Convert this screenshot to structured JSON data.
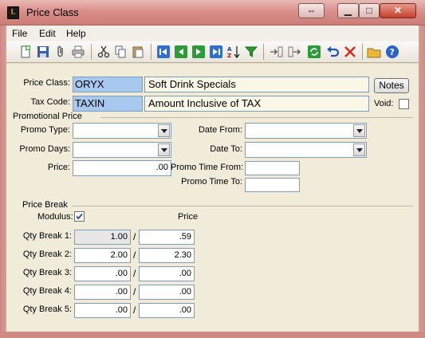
{
  "window": {
    "title": "Price Class",
    "icon_letter": "I."
  },
  "menu": [
    "File",
    "Edit",
    "Help"
  ],
  "header": {
    "price_class_label": "Price Class:",
    "price_class_code": "ORYX",
    "price_class_desc": "Soft Drink Specials",
    "notes_button": "Notes",
    "tax_code_label": "Tax Code:",
    "tax_code": "TAXIN",
    "tax_code_desc": "Amount Inclusive of TAX",
    "void_label": "Void:",
    "void_checked": false
  },
  "promo": {
    "section_title": "Promotional Price",
    "promo_type_label": "Promo Type:",
    "promo_type_value": "",
    "promo_days_label": "Promo Days:",
    "promo_days_value": "",
    "price_label": "Price:",
    "price_value": ".00",
    "date_from_label": "Date From:",
    "date_from_value": "",
    "date_to_label": "Date To:",
    "date_to_value": "",
    "time_from_label": "Promo Time From:",
    "time_from_value": "",
    "time_to_label": "Promo Time To:",
    "time_to_value": ""
  },
  "price_break": {
    "section_title": "Price Break",
    "modulus_label": "Modulus:",
    "modulus_checked": true,
    "price_header": "Price",
    "rows": [
      {
        "label": "Qty Break 1:",
        "qty": "1.00",
        "price": ".59"
      },
      {
        "label": "Qty Break 2:",
        "qty": "2.00",
        "price": "2.30"
      },
      {
        "label": "Qty Break 3:",
        "qty": ".00",
        "price": ".00"
      },
      {
        "label": "Qty Break 4:",
        "qty": ".00",
        "price": ".00"
      },
      {
        "label": "Qty Break 5:",
        "qty": ".00",
        "price": ".00"
      }
    ]
  },
  "toolbar_icons": [
    "new-icon",
    "save-icon",
    "attach-icon",
    "print-icon",
    "cut-icon",
    "copy-icon",
    "paste-icon",
    "first-record-icon",
    "previous-record-icon",
    "next-record-icon",
    "last-record-icon",
    "sort-az-icon",
    "filter-icon",
    "import-icon",
    "export-icon",
    "refresh-icon",
    "undo-icon",
    "delete-icon",
    "open-folder-icon",
    "help-icon"
  ]
}
